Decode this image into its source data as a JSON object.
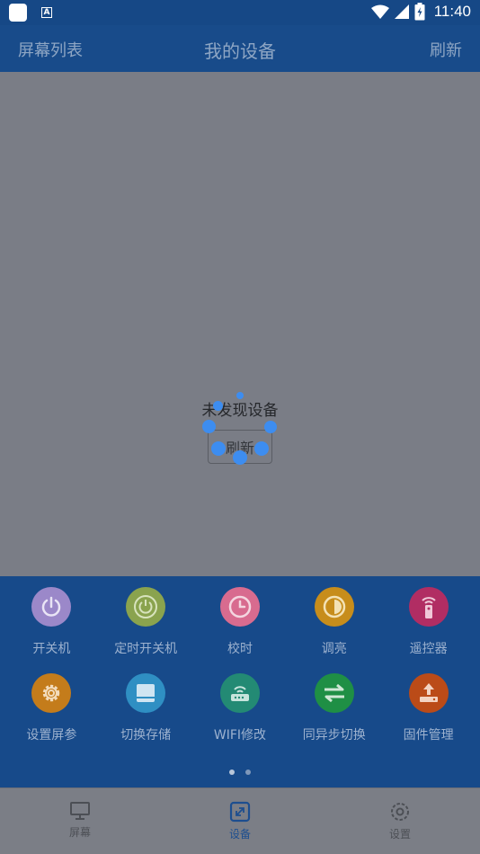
{
  "status_bar": {
    "time": "11:40"
  },
  "header": {
    "left_label": "屏幕列表",
    "title": "我的设备",
    "right_label": "刷新"
  },
  "main": {
    "empty_text": "未发现设备",
    "refresh_label": "刷新"
  },
  "functions": [
    {
      "label": "开关机",
      "icon": "power-icon",
      "color": "#9b88c9"
    },
    {
      "label": "定时开关机",
      "icon": "timer-power-icon",
      "color": "#8aa34e"
    },
    {
      "label": "校时",
      "icon": "clock-icon",
      "color": "#d86b8f"
    },
    {
      "label": "调亮",
      "icon": "brightness-icon",
      "color": "#c78d1b"
    },
    {
      "label": "遥控器",
      "icon": "remote-icon",
      "color": "#b12d63"
    },
    {
      "label": "设置屏参",
      "icon": "gear-icon",
      "color": "#c47c1b"
    },
    {
      "label": "切换存储",
      "icon": "storage-icon",
      "color": "#2f8fc3"
    },
    {
      "label": "WIFI修改",
      "icon": "router-icon",
      "color": "#238a74"
    },
    {
      "label": "同异步切换",
      "icon": "sync-switch-icon",
      "color": "#1f8f45"
    },
    {
      "label": "固件管理",
      "icon": "upload-icon",
      "color": "#bb4b18"
    }
  ],
  "pagination": {
    "pages": 2,
    "current": 1
  },
  "bottom_nav": [
    {
      "label": "屏幕",
      "icon": "monitor-icon"
    },
    {
      "label": "设备",
      "icon": "device-icon",
      "active": true
    },
    {
      "label": "设置",
      "icon": "settings-icon"
    }
  ]
}
